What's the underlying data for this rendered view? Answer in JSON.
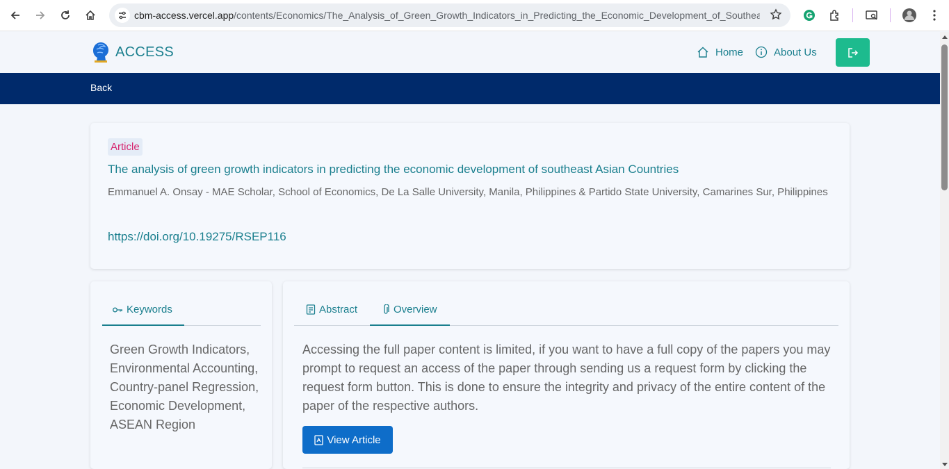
{
  "browser": {
    "url_domain": "cbm-access.vercel.app",
    "url_path": "/contents/Economics/The_Analysis_of_Green_Growth_Indicators_in_Predicting_the_Economic_Development_of_Southeast_..."
  },
  "header": {
    "brand": "ACCESS",
    "nav": {
      "home": "Home",
      "about": "About Us"
    }
  },
  "back_bar": {
    "back_label": "Back"
  },
  "article": {
    "badge": "Article",
    "title": "The analysis of green growth indicators in predicting the economic development of southeast Asian Countries",
    "authors": "Emmanuel A. Onsay - MAE Scholar, School of Economics, De La Salle University, Manila, Philippines & Partido State University, Camarines Sur, Philippines",
    "doi": "https://doi.org/10.19275/RSEP116"
  },
  "keywords_panel": {
    "tab_label": "Keywords",
    "text": "Green Growth Indicators, Environmental Accounting, Country-panel Regression, Economic Development, ASEAN Region"
  },
  "content_panel": {
    "tabs": {
      "abstract": "Abstract",
      "overview": "Overview"
    },
    "active_tab": "Overview",
    "overview_text": "Accessing the full paper content is limited, if you want to have a full copy of the papers you may prompt to request an access of the paper through sending us a request form by clicking the request form button. This is done to ensure the integrity and privacy of the entire content of the paper of the respective authors.",
    "view_button": "View Article"
  },
  "colors": {
    "accent": "#1a7f8e",
    "navy_bar": "#002a6b",
    "logout_green": "#1dbb8e",
    "button_blue": "#0e6dc9",
    "badge_pink": "#d6246e"
  },
  "icons": [
    "back-arrow-icon",
    "forward-arrow-icon",
    "reload-icon",
    "home-icon",
    "site-settings-icon",
    "star-icon",
    "grammarly-icon",
    "extensions-icon",
    "cast-icon",
    "profile-avatar",
    "menu-dots-icon",
    "house-icon",
    "info-icon",
    "logout-icon",
    "key-icon",
    "document-icon",
    "paperclip-icon",
    "pdf-icon"
  ]
}
